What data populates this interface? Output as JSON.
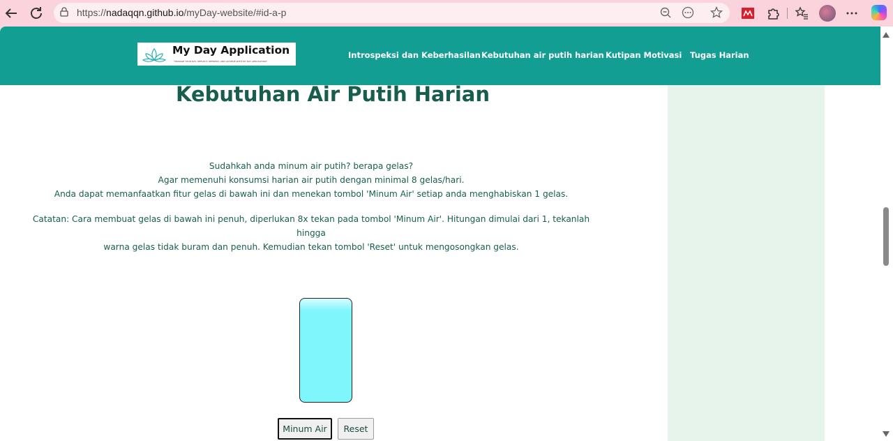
{
  "browser": {
    "url_prefix": "https://",
    "url_domain": "nadaqqn.github.io",
    "url_path": "/myDay-website/#id-a-p",
    "icons": [
      "back-icon",
      "refresh-icon",
      "lock-icon",
      "zoom-out-icon",
      "more-icon",
      "star-icon",
      "extension-red-icon",
      "puzzle-icon",
      "favorites-icon",
      "profile-avatar",
      "menu-dots-icon",
      "copilot-icon"
    ]
  },
  "header": {
    "brand": "My Day Application",
    "tagline": "\"MANAGE YOUR DAY, REFLECT, REFRESH, AND ACHIEVE WITH MY DAY APPLICATION\"",
    "nav": [
      {
        "label": "Introspeksi dan Keberhasilan"
      },
      {
        "label": "Kebutuhan air putih harian"
      },
      {
        "label": "Kutipan Motivasi"
      },
      {
        "label": "Tugas Harian"
      }
    ]
  },
  "main": {
    "title": "Kebutuhan Air Putih Harian",
    "intro": [
      "Sudahkah anda minum air putih? berapa gelas?",
      "Agar memenuhi konsumsi harian air putih dengan minimal 8 gelas/hari.",
      "Anda dapat memanfaatkan fitur gelas di bawah ini dan menekan tombol 'Minum Air' setiap anda menghabiskan 1 gelas."
    ],
    "note": [
      "Catatan: Cara membuat gelas di bawah ini penuh, diperlukan 8x tekan pada tombol 'Minum Air'. Hitungan dimulai dari 1, tekanlah hingga",
      "warna gelas tidak buram dan penuh. Kemudian tekan tombol 'Reset' untuk mengosongkan gelas."
    ],
    "glass_color": "#7ff6fb",
    "buttons": {
      "drink": "Minum Air",
      "reset": "Reset"
    }
  },
  "colors": {
    "header": "#139e93",
    "heading": "#175e4e",
    "sidebar": "#e6f4ec",
    "chrome": "#fbd3dd"
  }
}
